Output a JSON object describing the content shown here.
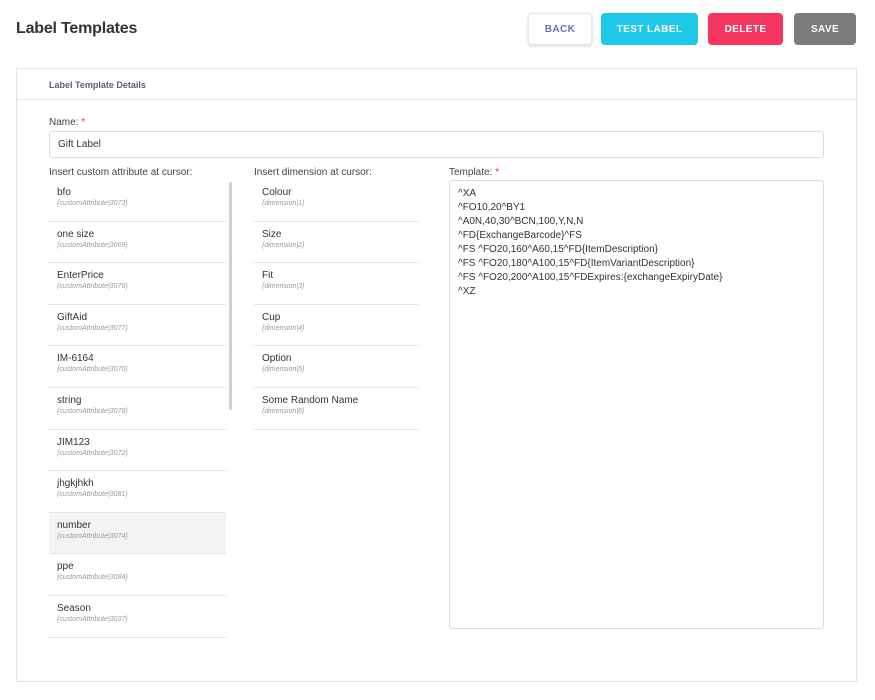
{
  "header": {
    "title": "Label Templates",
    "back_label": "BACK",
    "test_label": "TEST LABEL",
    "delete_label": "DELETE",
    "save_label": "SAVE"
  },
  "colors": {
    "accent_back": "#6b6fc7",
    "test": "#1dc8e8",
    "delete": "#f5345f",
    "save": "#7b7b7b",
    "required": "#e5344f"
  },
  "card": {
    "title": "Label Template Details"
  },
  "form": {
    "name_label": "Name:",
    "name_required": "*",
    "name_value": "Gift Label",
    "attributes_label": "Insert custom attribute at cursor:",
    "dimensions_label": "Insert dimension at cursor:",
    "template_label": "Template:",
    "template_required": "*",
    "template_value": "^XA\n^FO10,20^BY1\n^A0N,40,30^BCN,100,Y,N,N\n^FD{ExchangeBarcode}^FS\n^FS ^FO20,160^A60,15^FD{ItemDescription}\n^FS ^FO20,180^A100,15^FD{ItemVariantDescription}\n^FS ^FO20,200^A100,15^FDExpires:{exchangeExpiryDate}\n^XZ"
  },
  "attributes": [
    {
      "name": "bfo",
      "code": "{customAttribute|3073}"
    },
    {
      "name": "one size",
      "code": "{customAttribute|3069}"
    },
    {
      "name": "EnterPrice",
      "code": "{customAttribute|3076}"
    },
    {
      "name": "GiftAid",
      "code": "{customAttribute|3077}"
    },
    {
      "name": "IM-6164",
      "code": "{customAttribute|3070}"
    },
    {
      "name": "string",
      "code": "{customAttribute|3078}"
    },
    {
      "name": "JIM123",
      "code": "{customAttribute|3072}"
    },
    {
      "name": "jhgkjhkh",
      "code": "{customAttribute|3081}"
    },
    {
      "name": "number",
      "code": "{customAttribute|3074}"
    },
    {
      "name": "ppe",
      "code": "{customAttribute|3084}"
    },
    {
      "name": "Season",
      "code": "{customAttribute|3037}"
    }
  ],
  "dimensions": [
    {
      "name": "Colour",
      "code": "{dimension|1}"
    },
    {
      "name": "Size",
      "code": "{dimension|2}"
    },
    {
      "name": "Fit",
      "code": "{dimension|3}"
    },
    {
      "name": "Cup",
      "code": "{dimension|4}"
    },
    {
      "name": "Option",
      "code": "{dimension|5}"
    },
    {
      "name": "Some Random Name",
      "code": "{dimension|6}"
    }
  ]
}
